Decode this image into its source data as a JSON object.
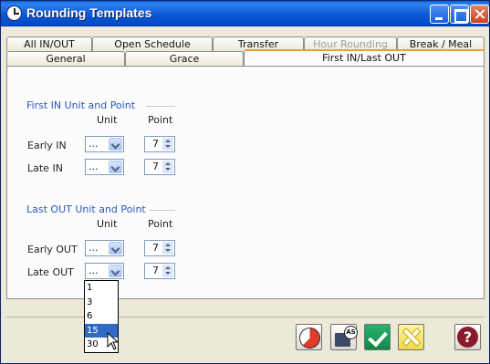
{
  "window": {
    "title": "Rounding Templates"
  },
  "tabs": {
    "row1": [
      {
        "label": "All IN/OUT",
        "disabled": false
      },
      {
        "label": "Open Schedule",
        "disabled": false
      },
      {
        "label": "Transfer",
        "disabled": false
      },
      {
        "label": "Hour Rounding",
        "disabled": true
      },
      {
        "label": "Break / Meal",
        "disabled": false
      }
    ],
    "row2": [
      {
        "label": "General",
        "active": false
      },
      {
        "label": "Grace",
        "active": false
      },
      {
        "label": "First IN/Last OUT",
        "active": true
      }
    ]
  },
  "first_in": {
    "group_title": "First IN Unit and Point",
    "col_unit": "Unit",
    "col_point": "Point",
    "rows": [
      {
        "label": "Early IN",
        "unit": "...",
        "point": "7"
      },
      {
        "label": "Late IN",
        "unit": "...",
        "point": "7"
      }
    ]
  },
  "last_out": {
    "group_title": "Last OUT Unit and Point",
    "col_unit": "Unit",
    "col_point": "Point",
    "rows": [
      {
        "label": "Early OUT",
        "unit": "...",
        "point": "7"
      },
      {
        "label": "Late OUT",
        "unit": "...",
        "point": "7"
      }
    ]
  },
  "unit_dropdown": {
    "options": [
      "1",
      "3",
      "6",
      "15",
      "30"
    ],
    "highlighted": "15"
  },
  "toolbar": {
    "icons": [
      "clock-icon",
      "save-as-icon",
      "checkmark-icon",
      "cancel-icon",
      "help-icon"
    ]
  }
}
